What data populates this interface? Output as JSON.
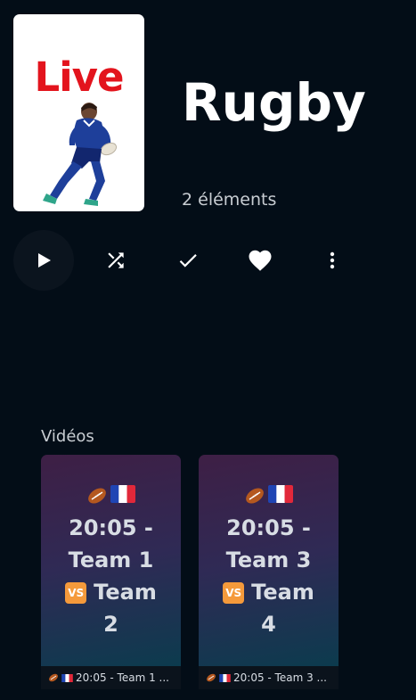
{
  "header": {
    "cover_text": "Live",
    "title": "Rugby",
    "item_count": "2 éléments"
  },
  "toolbar": {
    "buttons": [
      {
        "name": "play",
        "icon": "play-icon"
      },
      {
        "name": "shuffle",
        "icon": "shuffle-icon"
      },
      {
        "name": "mark-watched",
        "icon": "check-icon"
      },
      {
        "name": "favorite",
        "icon": "heart-icon"
      },
      {
        "name": "more",
        "icon": "more-vertical-icon"
      }
    ]
  },
  "section": {
    "title": "Vidéos"
  },
  "videos": [
    {
      "icons": [
        "rugby-ball-icon",
        "france-flag-icon"
      ],
      "line1": "20:05 -",
      "line2": "Team 1",
      "line3_vs": "VS",
      "line3": "Team",
      "line4": "2",
      "caption": "20:05 - Team 1 ..."
    },
    {
      "icons": [
        "rugby-ball-icon",
        "france-flag-icon"
      ],
      "line1": "20:05 -",
      "line2": "Team 3",
      "line3_vs": "VS",
      "line3": "Team",
      "line4": "4",
      "caption": "20:05 - Team 3 ..."
    }
  ],
  "colors": {
    "background": "#030d17",
    "accent_live": "#e3141d",
    "vs_badge": "#f59a3b"
  }
}
